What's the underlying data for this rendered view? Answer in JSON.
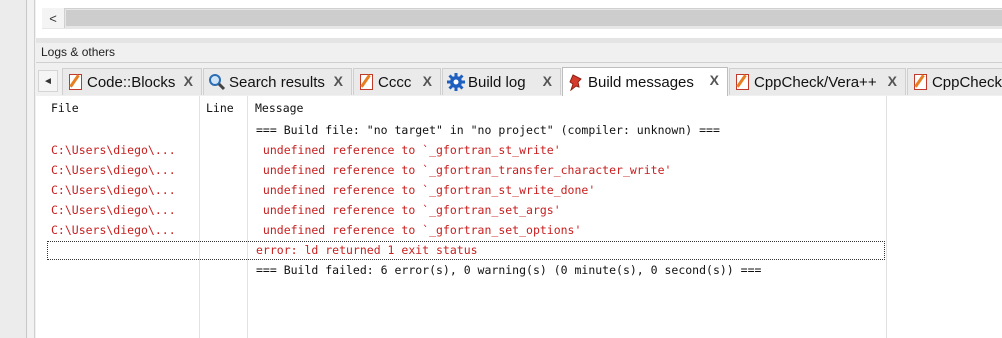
{
  "panel": {
    "title": "Logs & others"
  },
  "tabs": [
    {
      "label": "Code::Blocks",
      "icon": "document-pencil-icon",
      "close": "X"
    },
    {
      "label": "Search results",
      "icon": "search-icon",
      "close": "X"
    },
    {
      "label": "Cccc",
      "icon": "document-pencil-icon",
      "close": "X"
    },
    {
      "label": "Build log",
      "icon": "gear-icon",
      "close": "X"
    },
    {
      "label": "Build messages",
      "icon": "pushpin-icon",
      "close": "X"
    },
    {
      "label": "CppCheck/Vera++",
      "icon": "document-pencil-icon",
      "close": "X"
    },
    {
      "label": "CppCheck",
      "icon": "document-pencil-icon"
    }
  ],
  "columns": {
    "file": "File",
    "line": "Line",
    "message": "Message"
  },
  "rows": [
    {
      "file": "",
      "line": "",
      "message": "=== Build file: \"no target\" in \"no project\" (compiler: unknown) ==="
    },
    {
      "file": "C:\\Users\\diego\\...",
      "line": "",
      "message": " undefined reference to `_gfortran_st_write'"
    },
    {
      "file": "C:\\Users\\diego\\...",
      "line": "",
      "message": " undefined reference to `_gfortran_transfer_character_write'"
    },
    {
      "file": "C:\\Users\\diego\\...",
      "line": "",
      "message": " undefined reference to `_gfortran_st_write_done'"
    },
    {
      "file": "C:\\Users\\diego\\...",
      "line": "",
      "message": " undefined reference to `_gfortran_set_args'"
    },
    {
      "file": "C:\\Users\\diego\\...",
      "line": "",
      "message": " undefined reference to `_gfortran_set_options'"
    },
    {
      "file": "",
      "line": "",
      "message": "error: ld returned 1 exit status"
    },
    {
      "file": "",
      "line": "",
      "message": "=== Build failed: 6 error(s), 0 warning(s) (0 minute(s), 0 second(s)) ==="
    }
  ],
  "colors": {
    "error": "#c81e1e",
    "normal": "#111111"
  },
  "scroll": {
    "left_arrow": "<",
    "tab_left_arrow": "◄"
  }
}
